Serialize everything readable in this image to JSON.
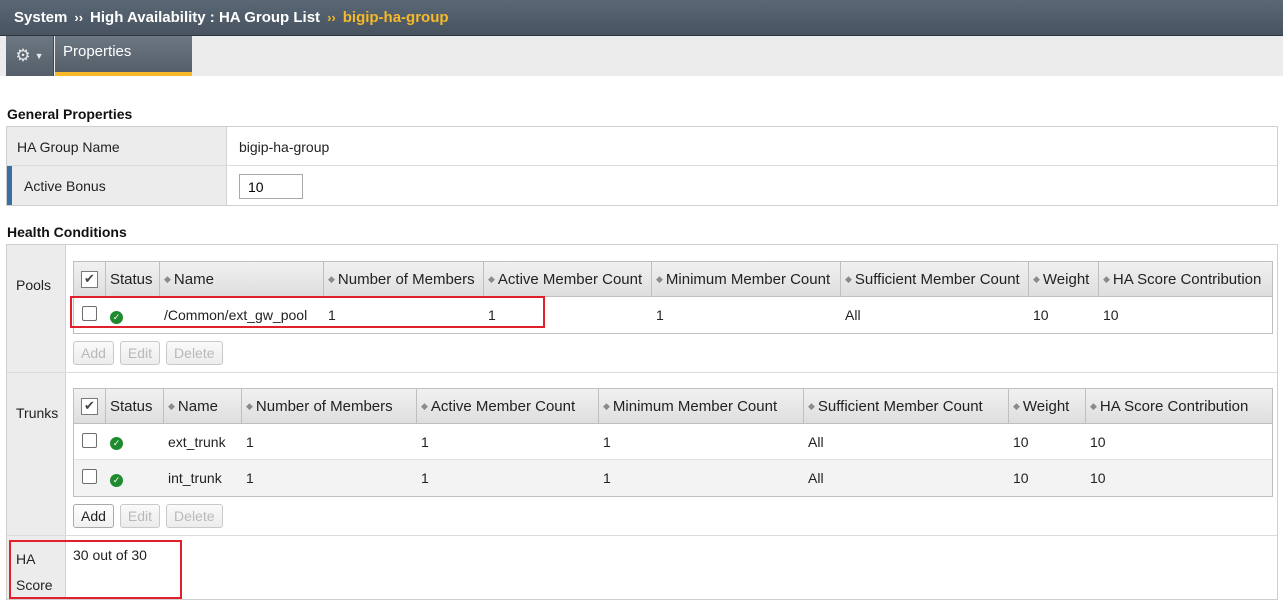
{
  "breadcrumb": {
    "root": "System",
    "sep": "››",
    "section": "High Availability : HA Group List",
    "current": "bigip-ha-group"
  },
  "toolbar": {
    "gear_icon": "gear-icon",
    "tab_label": "Properties"
  },
  "general": {
    "title": "General Properties",
    "name_label": "HA Group Name",
    "name_value": "bigip-ha-group",
    "bonus_label": "Active Bonus",
    "bonus_value": "10"
  },
  "health": {
    "title": "Health Conditions",
    "pools": {
      "label": "Pools",
      "columns": [
        "Status",
        "Name",
        "Number of Members",
        "Active Member Count",
        "Minimum Member Count",
        "Sufficient Member Count",
        "Weight",
        "HA Score Contribution"
      ],
      "rows": [
        {
          "name": "/Common/ext_gw_pool",
          "members": "1",
          "active": "1",
          "minimum": "1",
          "sufficient": "All",
          "weight": "10",
          "contribution": "10"
        }
      ],
      "buttons": {
        "add": "Add",
        "edit": "Edit",
        "delete": "Delete"
      }
    },
    "trunks": {
      "label": "Trunks",
      "columns": [
        "Status",
        "Name",
        "Number of Members",
        "Active Member Count",
        "Minimum Member Count",
        "Sufficient Member Count",
        "Weight",
        "HA Score Contribution"
      ],
      "rows": [
        {
          "name": "ext_trunk",
          "members": "1",
          "active": "1",
          "minimum": "1",
          "sufficient": "All",
          "weight": "10",
          "contribution": "10"
        },
        {
          "name": "int_trunk",
          "members": "1",
          "active": "1",
          "minimum": "1",
          "sufficient": "All",
          "weight": "10",
          "contribution": "10"
        }
      ],
      "buttons": {
        "add": "Add",
        "edit": "Edit",
        "delete": "Delete"
      }
    },
    "score": {
      "label_line1": "HA",
      "label_line2": "Score",
      "value": "30 out of 30"
    }
  },
  "colors": {
    "accent": "#f7b928",
    "highlight": "#e0202b",
    "status_ok": "#1f8a2e"
  }
}
